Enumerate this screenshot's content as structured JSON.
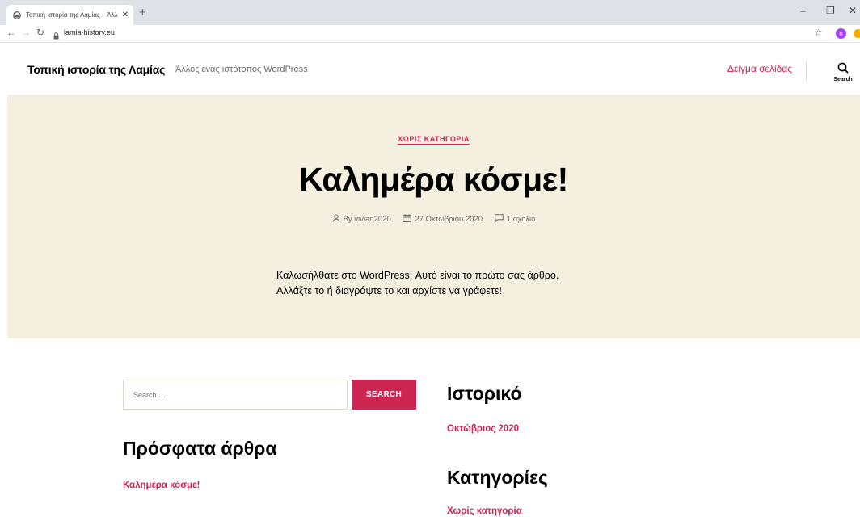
{
  "browser": {
    "tab_title": "Τοπική ιστορία της Λαμίας – Άλλ",
    "url": "lamia-history.eu",
    "profile_initial": "n"
  },
  "site": {
    "title": "Τοπική ιστορία της Λαμίας",
    "description": "Άλλος ένας ιστότοπος WordPress",
    "nav_link": "Δείγμα σελίδας",
    "search_label": "Search"
  },
  "post": {
    "category": "ΧΩΡΙΣ ΚΑΤΗΓΟΡΙΑ",
    "title": "Καλημέρα κόσμε!",
    "author": "By vivian2020",
    "date": "27 Οκτωβρίου 2020",
    "comments": "1 σχόλιο",
    "excerpt": "Καλωσήλθατε στο WordPress! Αυτό είναι το πρώτο σας άρθρο. Αλλάξτε το ή διαγράψτε το και αρχίστε να γράφετε!"
  },
  "widgets": {
    "search_placeholder": "Search …",
    "search_button": "SEARCH",
    "recent_title": "Πρόσφατα άρθρα",
    "recent_items": [
      "Καλημέρα κόσμε!"
    ],
    "archives_title": "Ιστορικό",
    "archives_items": [
      "Οκτώβριος 2020"
    ],
    "categories_title": "Κατηγορίες",
    "categories_items": [
      "Χωρίς κατηγορία"
    ]
  },
  "colors": {
    "accent": "#cd2653",
    "hero_background": "#f5efe0"
  }
}
